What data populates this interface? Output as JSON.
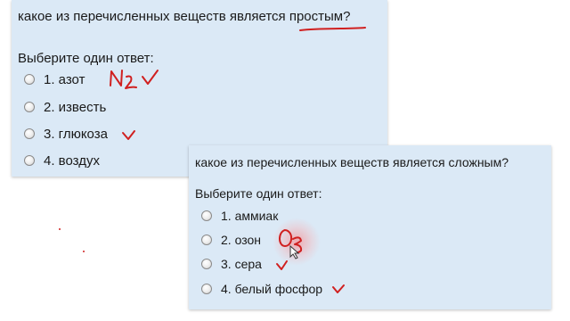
{
  "quiz1": {
    "question_pre": "какое из перечисленных веществ является ",
    "question_key": "простым",
    "question_post": "?",
    "prompt": "Выберите один ответ:",
    "options": [
      "1. азот",
      "2. известь",
      "3. глюкоза",
      "4. воздух"
    ],
    "handwriting": "N₂"
  },
  "quiz2": {
    "question": "какое из перечисленных веществ является сложным?",
    "prompt": "Выберите один ответ:",
    "options": [
      "1. аммиак",
      "2. озон",
      "3. сера",
      "4. белый фосфор"
    ],
    "handwriting": "O₃"
  },
  "colors": {
    "card_bg": "#dbe9f6",
    "ink": "#d02020"
  }
}
